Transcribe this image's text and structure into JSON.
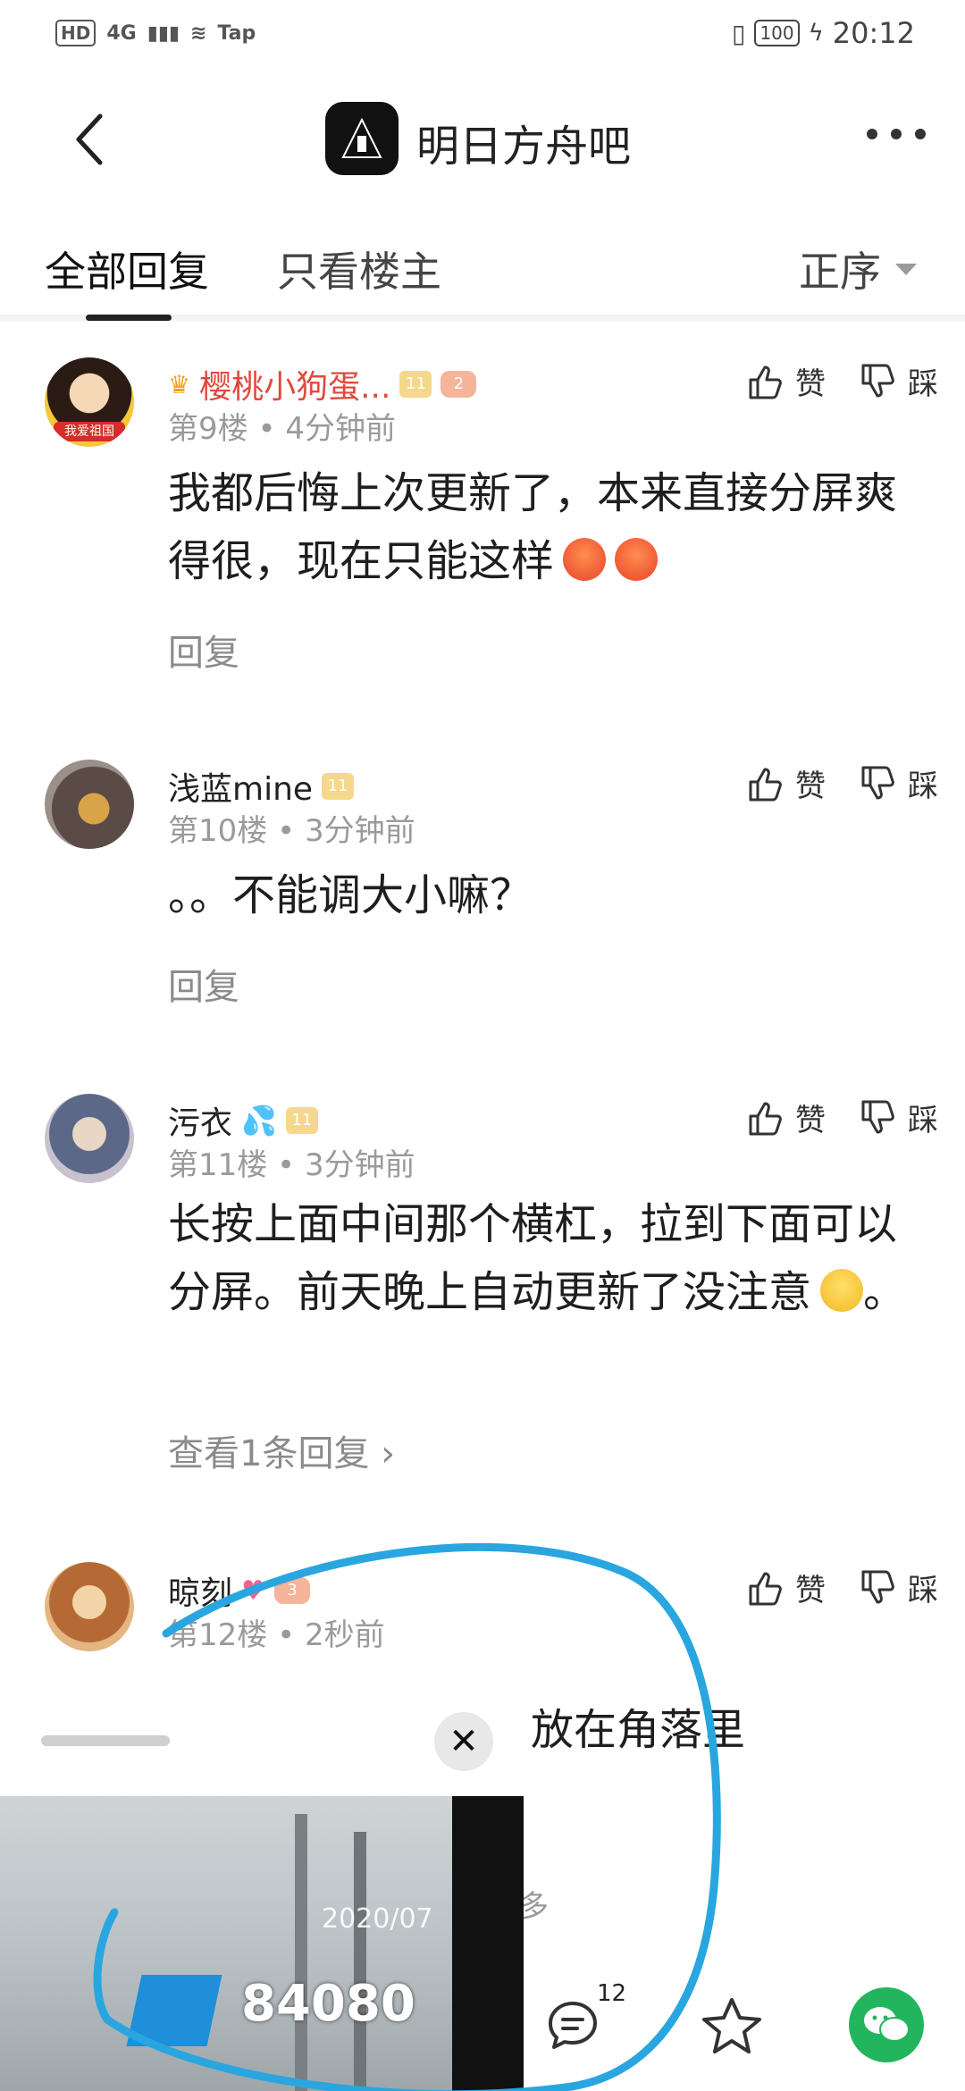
{
  "status_bar": {
    "hd": "HD",
    "network": "4G",
    "tap": "Tap",
    "battery": "100",
    "time": "20:12"
  },
  "header": {
    "forum_title": "明日方舟吧"
  },
  "tabs": {
    "all_replies": "全部回复",
    "op_only": "只看楼主",
    "sort": "正序"
  },
  "comments": [
    {
      "username": "樱桃小狗蛋...",
      "level": "11",
      "badge": "2",
      "floor": "第9楼",
      "time": "4分钟前",
      "text": "我都后悔上次更新了，本来直接分屏爽得很，现在只能这样",
      "reply_label": "回复",
      "avatar_caption": "我爱祖国",
      "like": "赞",
      "dislike": "踩"
    },
    {
      "username": "浅蓝mine",
      "level": "11",
      "floor": "第10楼",
      "time": "3分钟前",
      "text": "。。不能调大小嘛？",
      "reply_label": "回复",
      "like": "赞",
      "dislike": "踩"
    },
    {
      "username": "污衣",
      "level": "11",
      "floor": "第11楼",
      "time": "3分钟前",
      "text": "长按上面中间那个横杠，拉到下面可以分屏。前天晚上自动更新了没注意",
      "text_tail": "。",
      "reply_label": "查看1条回复",
      "like": "赞",
      "dislike": "踩"
    },
    {
      "username": "晾刻",
      "badge": "3",
      "floor": "第12楼",
      "time": "2秒前",
      "text_partial": "放在角落里",
      "more_partial": "多",
      "like": "赞",
      "dislike": "踩"
    }
  ],
  "pip": {
    "date_text": "2020/07",
    "score": "84080",
    "close": "✕"
  },
  "bottom_bar": {
    "comment_count": "12"
  },
  "colors": {
    "accent_red": "#e2483c",
    "scribble_blue": "#29a6df",
    "wechat_green": "#22b55e"
  }
}
